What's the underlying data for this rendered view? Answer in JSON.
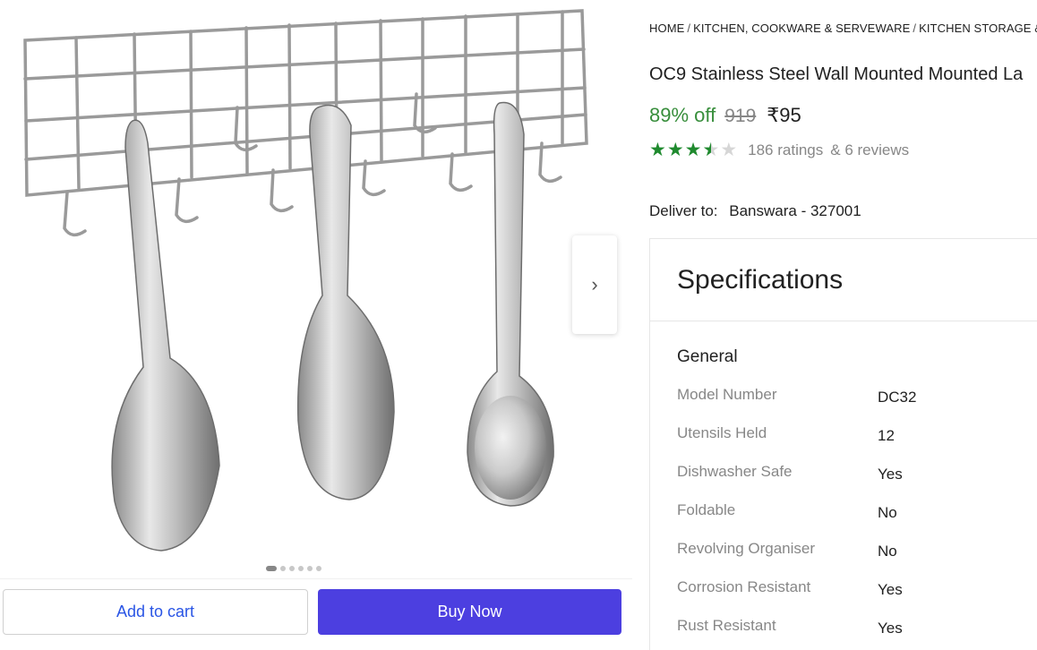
{
  "gallery": {
    "image_alt": "Stainless steel wall mounted ladle stand with hooks holding three serving spoons",
    "dots_count": 6,
    "active_dot": 0
  },
  "actions": {
    "add_to_cart": "Add to cart",
    "buy_now": "Buy Now"
  },
  "breadcrumb": [
    "HOME",
    "KITCHEN, COOKWARE & SERVEWARE",
    "KITCHEN STORAGE & CO"
  ],
  "product": {
    "title": "OC9 Stainless Steel Wall Mounted Mounted La",
    "discount": "89% off",
    "mrp": "919",
    "price": "₹95",
    "rating_value": 3.5,
    "ratings_text": "186 ratings",
    "reviews_text": "& 6 reviews"
  },
  "delivery": {
    "label": "Deliver to:",
    "location": "Banswara - 327001"
  },
  "specifications": {
    "heading": "Specifications",
    "group": "General",
    "rows": [
      {
        "key": "Model Number",
        "value": "DC32"
      },
      {
        "key": "Utensils Held",
        "value": "12"
      },
      {
        "key": "Dishwasher Safe",
        "value": "Yes"
      },
      {
        "key": "Foldable",
        "value": "No"
      },
      {
        "key": "Revolving Organiser",
        "value": "No"
      },
      {
        "key": "Corrosion Resistant",
        "value": "Yes"
      },
      {
        "key": "Rust Resistant",
        "value": "Yes"
      }
    ]
  },
  "colors": {
    "discount_green": "#388e3c",
    "star_green": "#1f8a2e",
    "buy_button": "#4c3fe0",
    "cart_text": "#2a55e5"
  },
  "icons": {
    "next": "chevron-right-icon",
    "star": "star-icon"
  }
}
